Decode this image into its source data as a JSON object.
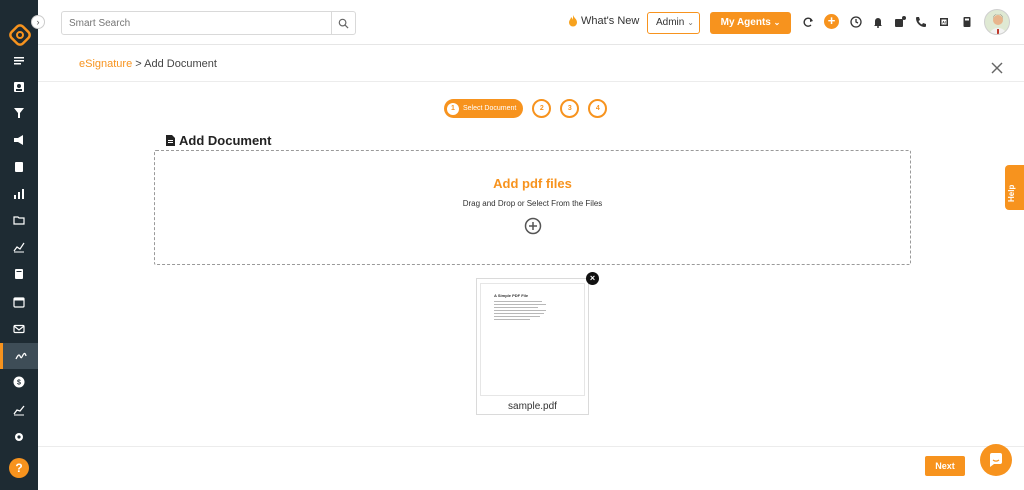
{
  "search": {
    "placeholder": "Smart Search"
  },
  "header": {
    "whats_new": "What's New",
    "role": "Admin",
    "agents_label": "My Agents"
  },
  "breadcrumb": {
    "parent": "eSignature",
    "separator": ">",
    "current": "Add Document"
  },
  "stepper": {
    "active_num": "1",
    "active_label": "Select Document",
    "steps": [
      "2",
      "3",
      "4"
    ]
  },
  "section": {
    "title": "Add Document"
  },
  "dropzone": {
    "title": "Add pdf files",
    "subtitle": "Drag and Drop or Select From the Files"
  },
  "file": {
    "name": "sample.pdf",
    "thumb_title": "A Simple PDF File"
  },
  "help": {
    "label": "Help"
  },
  "footer": {
    "next_label": "Next"
  },
  "colors": {
    "accent": "#f7931e",
    "sidebar": "#1e2b33"
  }
}
